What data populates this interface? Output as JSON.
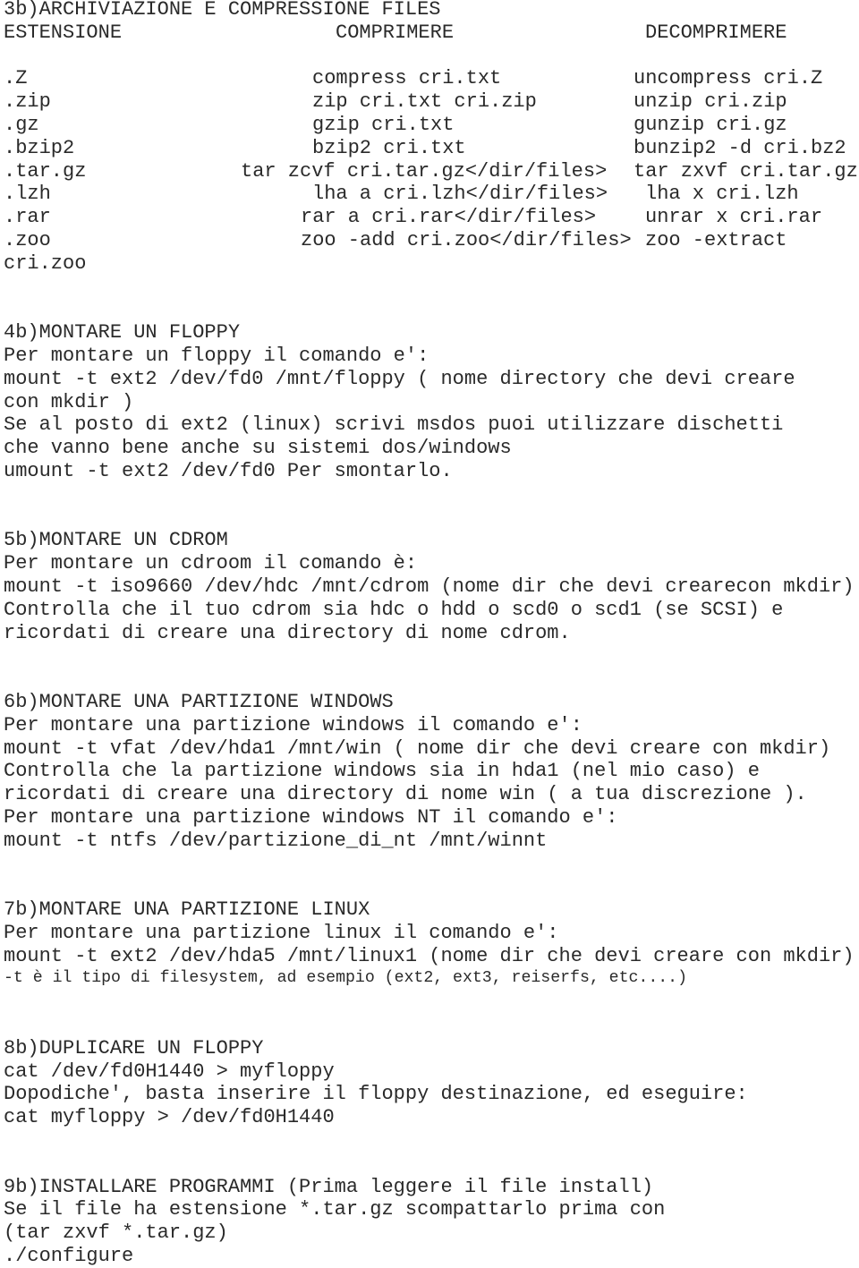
{
  "archiving": {
    "title": "3b)ARCHIVIAZIONE E COMPRESSIONE FILES",
    "headers": {
      "extension": "ESTENSIONE",
      "compress": "COMPRIMERE",
      "decompress": "DECOMPRIMERE"
    },
    "rows": [
      {
        "ext": ".Z",
        "compress": "compress cri.txt",
        "decompress": "uncompress cri.Z"
      },
      {
        "ext": ".zip",
        "compress": "zip cri.txt cri.zip",
        "decompress": "unzip cri.zip"
      },
      {
        "ext": ".gz",
        "compress": "gzip cri.txt",
        "decompress": "gunzip cri.gz"
      },
      {
        "ext": ".bzip2",
        "compress": "bzip2 cri.txt",
        "decompress": "bunzip2 -d cri.bz2"
      },
      {
        "ext": ".tar.gz",
        "compress": "tar zcvf cri.tar.gz</dir/files>",
        "decompress": "tar zxvf cri.tar.gz"
      },
      {
        "ext": ".lzh",
        "compress": "lha a cri.lzh</dir/files>",
        "decompress": "lha x cri.lzh"
      },
      {
        "ext": ".rar",
        "compress": "rar a cri.rar</dir/files>",
        "decompress": "unrar x cri.rar"
      },
      {
        "ext": ".zoo",
        "compress": "zoo -add cri.zoo</dir/files>",
        "decompress": "zoo -extract"
      }
    ],
    "wrap": "cri.zoo"
  },
  "floppy": {
    "title": "4b)MONTARE UN FLOPPY",
    "lines": [
      "Per montare un floppy il comando e':",
      "mount -t ext2 /dev/fd0 /mnt/floppy ( nome directory che devi creare",
      "con mkdir )",
      "Se al posto di ext2 (linux) scrivi msdos puoi utilizzare dischetti",
      "che vanno bene anche su sistemi dos/windows",
      "umount -t ext2 /dev/fd0 Per smontarlo."
    ]
  },
  "cdrom": {
    "title": "5b)MONTARE UN CDROM",
    "lines": [
      "Per montare un cdroom il comando è:",
      "mount -t iso9660 /dev/hdc /mnt/cdrom (nome dir che devi crearecon mkdir)",
      "Controlla che il tuo cdrom sia hdc o hdd o scd0 o scd1 (se SCSI) e",
      "ricordati di creare una directory di nome cdrom."
    ]
  },
  "windows": {
    "title": "6b)MONTARE UNA PARTIZIONE WINDOWS",
    "lines": [
      "Per montare una partizione windows il comando e':",
      "mount -t vfat /dev/hda1 /mnt/win ( nome dir che devi creare con mkdir)",
      "Controlla che la partizione windows sia in hda1 (nel mio caso) e",
      "ricordati di creare una directory di nome win ( a tua discrezione ).",
      "Per montare una partizione windows NT il comando e':",
      "mount -t ntfs /dev/partizione_di_nt /mnt/winnt"
    ]
  },
  "linux": {
    "title": "7b)MONTARE UNA PARTIZIONE LINUX",
    "lines": [
      "Per montare una partizione linux il comando e':",
      "mount -t ext2 /dev/hda5 /mnt/linux1 (nome dir che devi creare con mkdir)"
    ],
    "note": "-t è il tipo di filesystem, ad esempio (ext2, ext3, reiserfs, etc....)"
  },
  "duplicate": {
    "title": "8b)DUPLICARE UN FLOPPY",
    "lines": [
      "cat /dev/fd0H1440 > myfloppy",
      "Dopodiche', basta inserire il floppy destinazione, ed eseguire:",
      "cat myfloppy > /dev/fd0H1440"
    ]
  },
  "install": {
    "title": "9b)INSTALLARE PROGRAMMI (Prima leggere il file install)",
    "lines": [
      "Se il file ha estensione *.tar.gz scompattarlo prima con",
      "(tar zxvf *.tar.gz)",
      "./configure"
    ]
  }
}
